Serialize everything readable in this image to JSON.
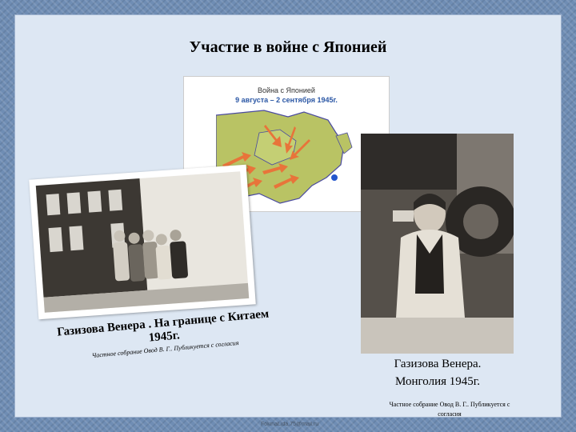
{
  "slide": {
    "title": "Участие в войне  с Японией",
    "map": {
      "title": "Война с Японией",
      "dates": "9 августа – 2 сентября 1945г.",
      "land_color": "#b9c364",
      "sea_color": "#ffffff",
      "arrow_color": "#e8743a",
      "border_color": "#4a4aa0"
    },
    "left_photo": {
      "caption_line1": "Газизова Венера . На границе с Китаем",
      "caption_line2": "1945г.",
      "credit": "Частное собрание Овод В. Г.. Публикуется с согласия"
    },
    "right_photo": {
      "caption_line1": "Газизова Венера.",
      "caption_line2": "Монголия 1945г.",
      "credit_line1": "Частное собрание Овод В. Г.. Публикуется с",
      "credit_line2": "согласия"
    },
    "watermark": "FokinaLida.75@mail.ru"
  }
}
